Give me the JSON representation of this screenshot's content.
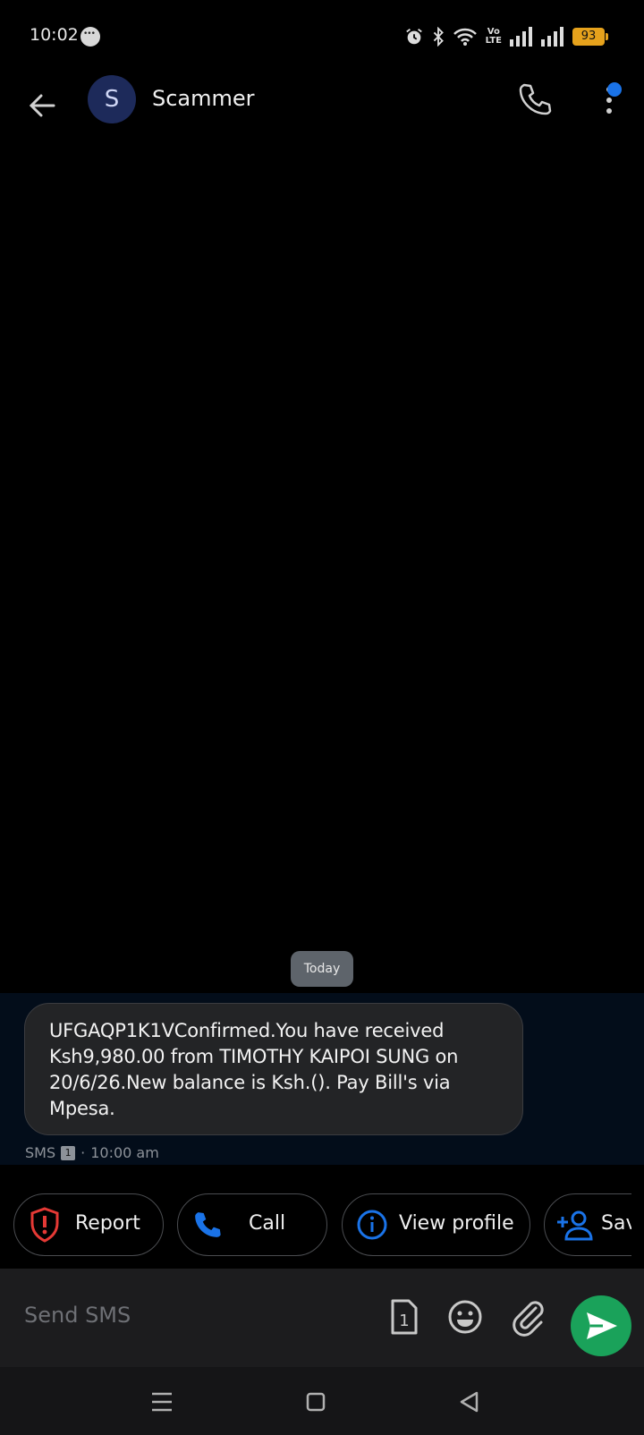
{
  "status_bar": {
    "time": "10:02",
    "battery": "93",
    "volte_top": "Vo",
    "volte_bottom": "LTE"
  },
  "header": {
    "avatar_letter": "S",
    "contact_name": "Scammer"
  },
  "conversation": {
    "date_label": "Today",
    "message": {
      "text": "UFGAQP1K1VConfirmed.You have received Ksh9,980.00 from TIMOTHY KAIPOI SUNG  on 20/6/26.New balance  is Ksh.(). Pay Bill's via Mpesa.",
      "channel": "SMS",
      "sim": "1",
      "separator": "·",
      "time": "10:00 am"
    }
  },
  "quick_actions": [
    {
      "label": "Report",
      "icon": "shield-alert-icon"
    },
    {
      "label": "Call",
      "icon": "phone-icon"
    },
    {
      "label": "View profile",
      "icon": "info-icon"
    },
    {
      "label": "Sav",
      "icon": "add-person-icon"
    }
  ],
  "compose": {
    "placeholder": "Send SMS",
    "sim_label": "1"
  },
  "colors": {
    "accent_blue": "#1a73e8",
    "send_green": "#1aa25a",
    "report_red": "#e53935",
    "battery_yellow": "#e6a21c"
  }
}
